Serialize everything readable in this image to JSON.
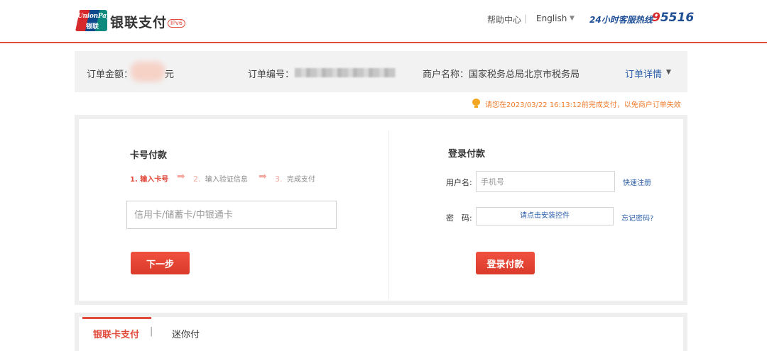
{
  "header": {
    "logo_line1": "UnionPay",
    "logo_line2": "银联",
    "brand": "银联支付",
    "ipv6": "IPv6",
    "help": "帮助中心",
    "separator": "|",
    "language": "English",
    "hotline_label": "24小时客服热线",
    "hotline_number": "95516",
    "accent_color": "#e24a3b"
  },
  "order": {
    "amount_label": "订单金额：",
    "amount_unit": "元",
    "number_label": "订单编号：",
    "merchant_label": "商户名称：",
    "merchant_name": "国家税务总局北京市税务局",
    "details_link": "订单详情"
  },
  "notice": {
    "text": "请您在2023/03/22 16:13:12前完成支付，以免商户订单失效"
  },
  "card_payment": {
    "title": "卡号付款",
    "steps": [
      {
        "num": "1.",
        "label": "输入卡号"
      },
      {
        "num": "2.",
        "label": "输入验证信息"
      },
      {
        "num": "3.",
        "label": "完成支付"
      }
    ],
    "card_placeholder": "信用卡/储蓄卡/中银通卡",
    "next_button": "下一步"
  },
  "login_payment": {
    "title": "登录付款",
    "username_label": "用户名:",
    "username_placeholder": "手机号",
    "register_link": "快速注册",
    "password_label": "密　码:",
    "password_prompt": "请点击安装控件",
    "forgot_link": "忘记密码?",
    "login_button": "登录付款"
  },
  "tabs": [
    {
      "label": "银联卡支付",
      "active": true
    },
    {
      "label": "迷你付",
      "active": false
    }
  ],
  "tab_separator": "|"
}
